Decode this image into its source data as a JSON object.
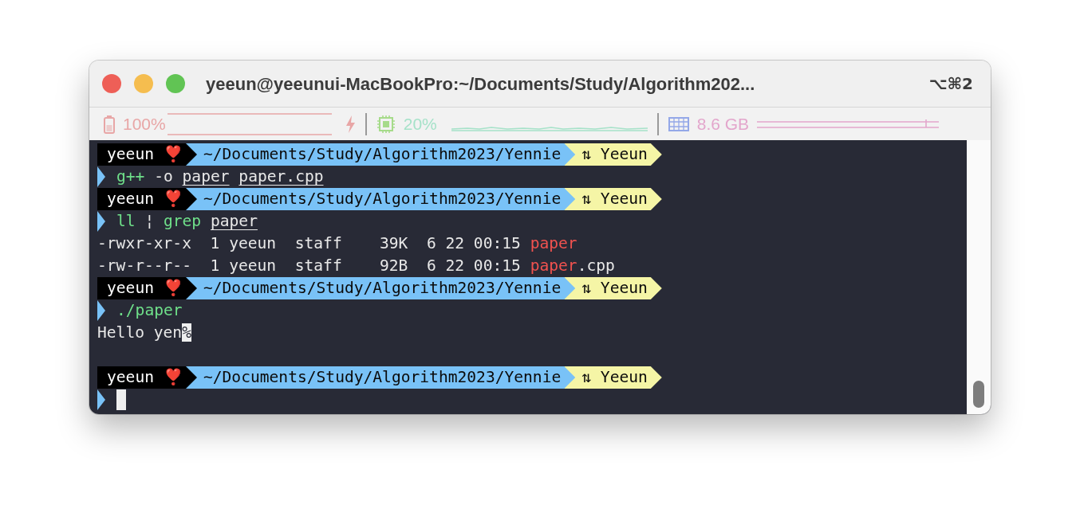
{
  "window": {
    "title": "yeeun@yeeunui-MacBookPro:~/Documents/Study/Algorithm202...",
    "shortcut": "⌥⌘2"
  },
  "status_bar": [
    {
      "kind": "battery",
      "value": "100%",
      "color": "#e8a6a6"
    },
    {
      "kind": "cpu",
      "value": "20%",
      "color": "#a6e2c9"
    },
    {
      "kind": "memory",
      "value": "8.6 GB",
      "color": "#e3a6cc"
    }
  ],
  "terminal": {
    "lines": [
      {
        "kind": "prompt",
        "user": "yeeun",
        "emoji": "❣️",
        "path": "~/Documents/Study/Algorithm2023/Yennie",
        "branch": "⇅ Yeeun"
      },
      {
        "kind": "command",
        "words": [
          {
            "text": "g++",
            "kind": "program"
          },
          {
            "text": "-o",
            "kind": "plain"
          },
          {
            "text": "paper",
            "kind": "path"
          },
          {
            "text": "paper.cpp",
            "kind": "path"
          }
        ]
      },
      {
        "kind": "prompt",
        "user": "yeeun",
        "emoji": "❣️",
        "path": "~/Documents/Study/Algorithm2023/Yennie",
        "branch": "⇅ Yeeun"
      },
      {
        "kind": "command",
        "words": [
          {
            "text": "ll",
            "kind": "program"
          },
          {
            "text": "¦",
            "kind": "plain"
          },
          {
            "text": "grep",
            "kind": "program"
          },
          {
            "text": "paper",
            "kind": "path"
          }
        ]
      },
      {
        "kind": "output",
        "tokens": [
          {
            "text": "-rwxr-xr-x  1 yeeun  staff    39K  6 22 00:15 ",
            "kind": "plain"
          },
          {
            "text": "paper",
            "kind": "match"
          }
        ]
      },
      {
        "kind": "output",
        "tokens": [
          {
            "text": "-rw-r--r--  1 yeeun  staff    92B  6 22 00:15 ",
            "kind": "plain"
          },
          {
            "text": "paper",
            "kind": "match"
          },
          {
            "text": ".cpp",
            "kind": "plain"
          }
        ]
      },
      {
        "kind": "prompt",
        "user": "yeeun",
        "emoji": "❣️",
        "path": "~/Documents/Study/Algorithm2023/Yennie",
        "branch": "⇅ Yeeun"
      },
      {
        "kind": "command",
        "words": [
          {
            "text": "./paper",
            "kind": "program"
          }
        ]
      },
      {
        "kind": "output",
        "tokens": [
          {
            "text": "Hello yen",
            "kind": "plain"
          },
          {
            "text": "%",
            "kind": "inverse"
          }
        ]
      },
      {
        "kind": "blank"
      },
      {
        "kind": "prompt",
        "user": "yeeun",
        "emoji": "❣️",
        "path": "~/Documents/Study/Algorithm2023/Yennie",
        "branch": "⇅ Yeeun"
      },
      {
        "kind": "input"
      }
    ]
  }
}
